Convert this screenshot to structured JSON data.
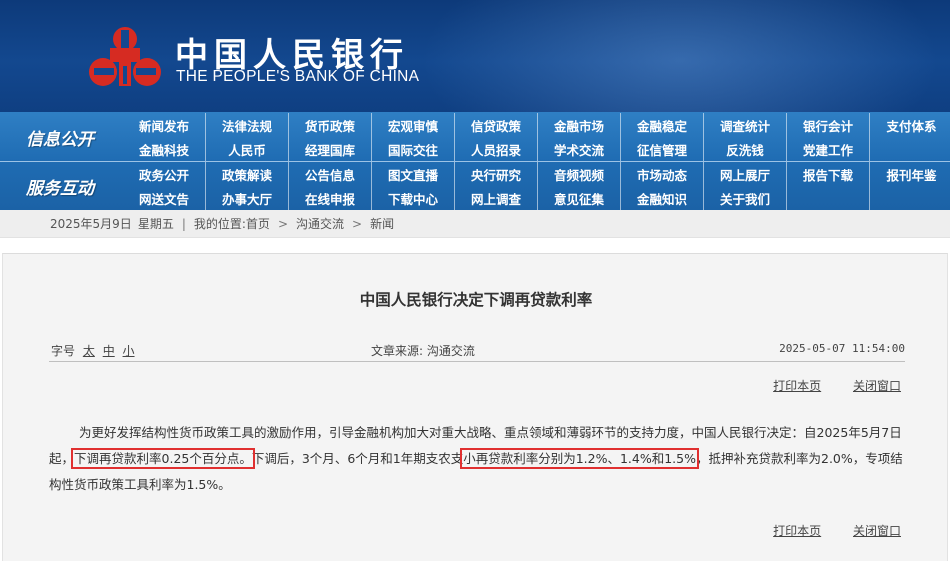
{
  "header": {
    "logo_cn": "中国人民银行",
    "logo_en": "THE PEOPLE'S BANK OF CHINA",
    "colors": {
      "banner": "#13488f",
      "logo_red": "#d62b22"
    }
  },
  "nav": {
    "sections": [
      {
        "label": "信息公开",
        "rows": [
          [
            "新闻发布",
            "法律法规",
            "货币政策",
            "宏观审慎",
            "信贷政策",
            "金融市场",
            "金融稳定",
            "调查统计",
            "银行会计",
            "支付体系"
          ],
          [
            "金融科技",
            "人民币",
            "经理国库",
            "国际交往",
            "人员招录",
            "学术交流",
            "征信管理",
            "反洗钱",
            "党建工作",
            ""
          ]
        ]
      },
      {
        "label": "服务互动",
        "rows": [
          [
            "政务公开",
            "政策解读",
            "公告信息",
            "图文直播",
            "央行研究",
            "音频视频",
            "市场动态",
            "网上展厅",
            "报告下载",
            "报刊年鉴"
          ],
          [
            "网送文告",
            "办事大厅",
            "在线申报",
            "下载中心",
            "网上调查",
            "意见征集",
            "金融知识",
            "关于我们",
            "",
            ""
          ]
        ]
      }
    ]
  },
  "breadcrumb": {
    "date": "2025年5月9日",
    "weekday": "星期五",
    "location_label": "我的位置:",
    "home": "首页",
    "level1": "沟通交流",
    "level2": "新闻",
    "sep1": "|",
    "sep2": ">",
    "sep3": ">"
  },
  "article": {
    "title": "中国人民银行决定下调再贷款利率",
    "font_size_label": "字号",
    "font_large": "太",
    "font_medium": "中",
    "font_small": "小",
    "source": "文章来源: 沟通交流",
    "datetime": "2025-05-07 11:54:00",
    "print": "打印本页",
    "close": "关闭窗口",
    "p1_before": "为更好发挥结构性货币政策工具的激励作用，引导金融机构加大对重大战略、重点领域和薄弱环节的支持力度，中国人民银行决定：自2025年5月7日起，",
    "p1_hl1": "下调再贷款利率0.25个百分点。",
    "p1_mid": "下调后，3个月、6个月和1年期支农支",
    "p1_hl2": "小再贷款利率分别为1.2%、1.4%和1.5%",
    "p1_after": "，抵押补充贷款利率为2.0%，专项结构性货币政策工具利率为1.5%。"
  }
}
